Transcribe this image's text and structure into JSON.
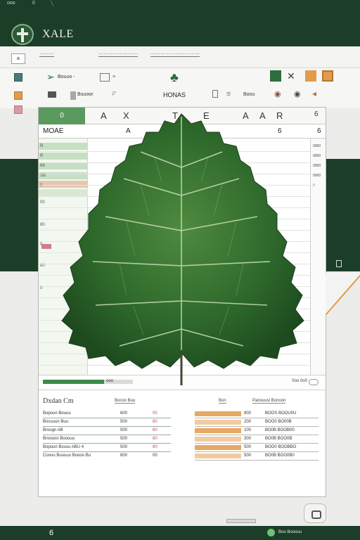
{
  "title_bar": {
    "left_text": "ooo",
    "num": "0"
  },
  "app": {
    "name": "XALE"
  },
  "menu": [
    "………",
    "……………………",
    "…………………………"
  ],
  "menu_doc_label": "a",
  "ribbon": {
    "center_label": "HONAS",
    "btn_a": "Bouuo -",
    "btn_b": "Buuoor",
    "right_text": "Boou"
  },
  "sheet": {
    "first_header": "0",
    "columns": [
      "A",
      "X",
      "T",
      "E",
      "A",
      "A",
      "R",
      "6"
    ],
    "formula": {
      "name_box": "MOAE",
      "col_a": "A",
      "col_b": "6",
      "col_c": "6"
    },
    "rows": [
      "R",
      "R",
      "69",
      "SB",
      "0",
      "00",
      "80",
      "0",
      "80",
      "0"
    ],
    "right_values": [
      "0000",
      "0000",
      "0000",
      "0000",
      "0"
    ]
  },
  "progress": {
    "fraction": 0.68,
    "label": "ooo",
    "right_text": "0oo 0o0"
  },
  "panel": {
    "title": "Dxdan Cm",
    "sub_left": "Bocoo Buu",
    "sub_mid": "Bon",
    "sub_right": "Panouusl Bonoon",
    "left_rows": [
      [
        "Bopoun Bouuu",
        "600",
        "00"
      ],
      [
        "Bocuuun Buu",
        "500",
        "80"
      ],
      [
        "Broogn AB",
        "500",
        "60"
      ],
      [
        "Broooon Booouu",
        "500",
        "80"
      ],
      [
        "Bopoun Bousu ABU 4",
        "500",
        "80"
      ],
      [
        "Cooou Buuuuu Boooo Bu",
        "600",
        "00"
      ]
    ],
    "right_rows": [
      [
        "800",
        "BOOS BOOU0U"
      ],
      [
        "200",
        "BOO0 BO00B"
      ],
      [
        "100",
        "BO0B BOOB00"
      ],
      [
        "300",
        "BO0B BOO0B"
      ],
      [
        "500",
        "BOO0 BOOBBO"
      ],
      [
        "500",
        "BO0B BOO0B0"
      ]
    ]
  },
  "status": {
    "left": "6",
    "right": "Boo Booouu"
  },
  "colors": {
    "brand": "#1c3d27",
    "accent": "#3d8a48",
    "orange": "#e29b4a",
    "pink": "#cf7d8c"
  }
}
